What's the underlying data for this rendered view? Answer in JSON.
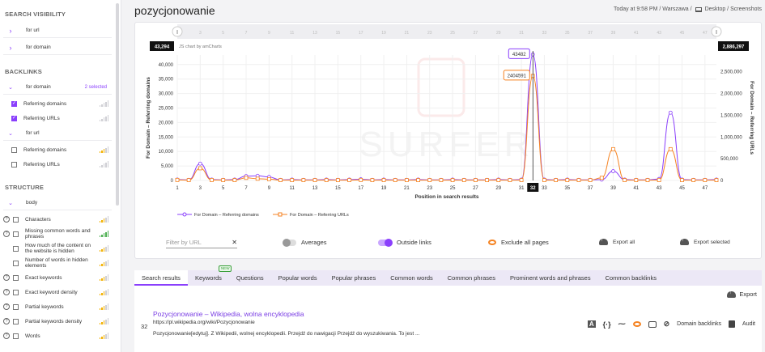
{
  "sidebar": {
    "search_visibility": {
      "heading": "SEARCH VISIBILITY",
      "items": [
        {
          "label": "for url"
        },
        {
          "label": "for domain"
        }
      ]
    },
    "backlinks": {
      "heading": "BACKLINKS",
      "for_domain": {
        "label": "for domain",
        "selected": "2 selected"
      },
      "for_domain_items": [
        {
          "label": "Referring domains",
          "checked": true
        },
        {
          "label": "Referring URLs",
          "checked": true
        }
      ],
      "for_url": {
        "label": "for url"
      },
      "for_url_items": [
        {
          "label": "Referring domains"
        },
        {
          "label": "Referring URLs"
        }
      ]
    },
    "structure": {
      "heading": "STRUCTURE",
      "body_label": "body",
      "items": [
        {
          "label": "Characters",
          "help": true
        },
        {
          "label": "Missing common words and phrases",
          "help": true
        },
        {
          "label": "How much of the content on the website is hidden",
          "help": false
        },
        {
          "label": "Number of words in hidden elements",
          "help": false
        },
        {
          "label": "Exact keywords",
          "help": true
        },
        {
          "label": "Exact keyword density",
          "help": true
        },
        {
          "label": "Partial keywords",
          "help": true
        },
        {
          "label": "Partial keywords density",
          "help": true
        },
        {
          "label": "Words",
          "help": true
        }
      ]
    }
  },
  "header": {
    "title": "pozycjonowanie",
    "meta": "Today at 9:58 PM / Warszawa / ",
    "device": "Desktop / Screenshots"
  },
  "chart_card": {
    "credit": "JS chart by amCharts",
    "cursor_left_value": "43,294",
    "cursor_right_value": "2,886,297",
    "cursor_x_label": "32",
    "balloon_domains": "43482",
    "balloon_urls": "2404591",
    "watermark": "SURFER",
    "scrollbar_left": "||",
    "scrollbar_right": "||"
  },
  "chart_data": {
    "type": "line",
    "xlabel": "Position in search results",
    "ylabel_left": "For Domain – Referring domains",
    "ylabel_right": "For Domain – Referring URLs",
    "x_ticks": [
      1,
      3,
      5,
      7,
      9,
      11,
      13,
      15,
      17,
      19,
      21,
      23,
      25,
      27,
      29,
      31,
      33,
      35,
      37,
      39,
      41,
      43,
      45,
      47
    ],
    "ylim_left": [
      0,
      43294
    ],
    "y_ticks_left": [
      0,
      5000,
      10000,
      15000,
      20000,
      25000,
      30000,
      35000,
      40000
    ],
    "y_tick_labels_left": [
      "0",
      "5,000",
      "10,000",
      "15,000",
      "20,000",
      "25,000",
      "30,000",
      "35,000",
      "40,000"
    ],
    "ylim_right": [
      0,
      2886297
    ],
    "y_ticks_right": [
      0,
      500000,
      1000000,
      1500000,
      2000000,
      2500000
    ],
    "y_tick_labels_right": [
      "0",
      "500,000",
      "1,000,000",
      "1,500,000",
      "2,000,000",
      "2,500,000"
    ],
    "x": [
      1,
      2,
      3,
      4,
      5,
      6,
      7,
      8,
      9,
      10,
      11,
      12,
      13,
      14,
      15,
      16,
      17,
      18,
      19,
      20,
      21,
      22,
      23,
      24,
      25,
      26,
      27,
      28,
      29,
      30,
      31,
      32,
      33,
      34,
      35,
      36,
      37,
      38,
      39,
      40,
      41,
      42,
      43,
      44,
      45,
      46,
      47,
      48
    ],
    "series": [
      {
        "name": "For Domain – Referring domains",
        "axis": "left",
        "color": "#8a3ffc",
        "values": [
          300,
          200,
          5800,
          300,
          200,
          300,
          1500,
          1600,
          1200,
          200,
          300,
          200,
          200,
          300,
          200,
          300,
          400,
          200,
          300,
          200,
          200,
          300,
          200,
          200,
          300,
          200,
          200,
          200,
          300,
          200,
          300,
          43482,
          300,
          200,
          300,
          200,
          200,
          300,
          3200,
          300,
          200,
          200,
          500,
          23400,
          300,
          200,
          200,
          300
        ]
      },
      {
        "name": "For Domain – Referring URLs",
        "axis": "right",
        "color": "#f58220",
        "values": [
          12000,
          8000,
          280000,
          10000,
          8000,
          8000,
          60000,
          40000,
          30000,
          8000,
          8000,
          8000,
          8000,
          8000,
          8000,
          8000,
          12000,
          8000,
          8000,
          8000,
          8000,
          8000,
          8000,
          8000,
          8000,
          8000,
          8000,
          8000,
          8000,
          8000,
          8000,
          2404591,
          8000,
          8000,
          8000,
          8000,
          8000,
          60000,
          720000,
          8000,
          8000,
          8000,
          8000,
          720000,
          8000,
          8000,
          8000,
          8000
        ]
      }
    ],
    "legend": [
      "For Domain – Referring domains",
      "For Domain – Referring URLs"
    ],
    "legend_position": "bottom-left"
  },
  "controls": {
    "filter_placeholder": "Filter by URL",
    "filter_clear": "✕",
    "averages": "Averages",
    "outside_links": "Outside links",
    "exclude_all": "Exclude all pages",
    "export_all": "Export all",
    "export_selected": "Export selected"
  },
  "tabs": [
    {
      "label": "Search results",
      "active": true
    },
    {
      "label": "Keywords",
      "badge": "NEW"
    },
    {
      "label": "Questions"
    },
    {
      "label": "Popular words"
    },
    {
      "label": "Popular phrases"
    },
    {
      "label": "Common words"
    },
    {
      "label": "Common phrases"
    },
    {
      "label": "Prominent words and phrases"
    },
    {
      "label": "Common backlinks"
    }
  ],
  "results": {
    "export": "Export",
    "row": {
      "position": "32",
      "title": "Pozycjonowanie – Wikipedia, wolna encyklopedia",
      "url": "https://pl.wikipedia.org/wiki/Pozycjonowanie",
      "snippet": "Pozycjonowanie[edytuj]. Z Wikipedii, wolnej encyklopedii. Przejdź do nawigacji Przejdź do wyszukiwania. To jest ...",
      "domain_backlinks": "Domain backlinks",
      "audit": "Audit"
    }
  },
  "colors": {
    "accent": "#8a3ffc",
    "orange": "#f58220"
  }
}
